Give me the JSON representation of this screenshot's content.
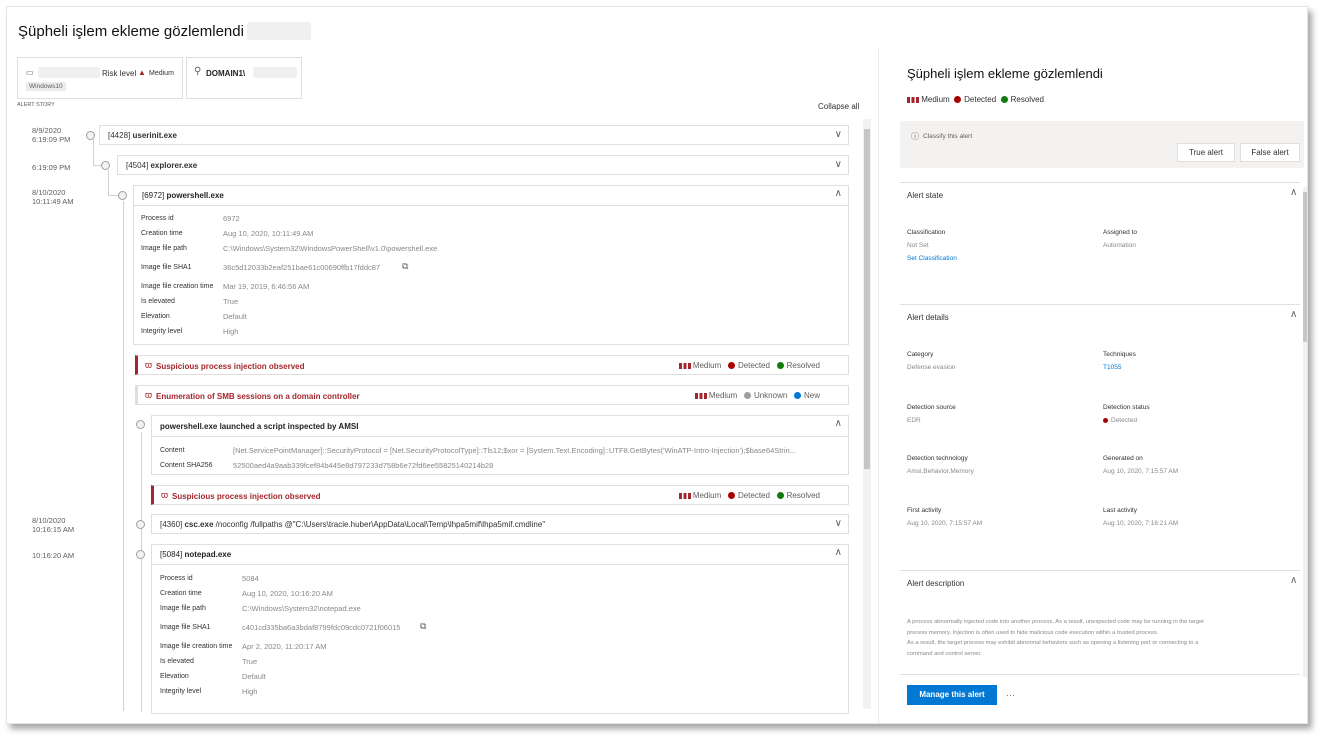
{
  "page_title": "Şüpheli işlem ekleme gözlemlendi",
  "device_card": {
    "risk_label": "Risk level",
    "risk_value": "Medium",
    "os_tag": "Windows10",
    "user": "DOMAIN1\\"
  },
  "alert_story_label": "ALERT STORY",
  "collapse_all": "Collapse all",
  "timeline": {
    "dates": [
      {
        "d": "8/9/2020",
        "t": "6:19:09 PM"
      },
      {
        "d": "",
        "t": "6:19:09 PM"
      },
      {
        "d": "8/10/2020",
        "t": "10:11:49 AM"
      },
      {
        "d": "8/10/2020",
        "t": "10:16:15 AM"
      },
      {
        "d": "",
        "t": "10:16:20 AM"
      }
    ],
    "proc1": {
      "pid": "[4428]",
      "name": "userinit.exe"
    },
    "proc2": {
      "pid": "[4504]",
      "name": "explorer.exe"
    },
    "proc3": {
      "pid": "[6972]",
      "name": "powershell.exe"
    },
    "proc3_details": [
      {
        "k": "Process id",
        "v": "6972"
      },
      {
        "k": "Creation time",
        "v": "Aug 10, 2020, 10:11:49 AM"
      },
      {
        "k": "Image file path",
        "v": "C:\\Windows\\System32\\WindowsPowerShell\\v1.0\\powershell.exe"
      },
      {
        "k": "Image file SHA1",
        "v": "36c5d12033b2eaf251bae61c00690ffb17fddc87"
      },
      {
        "k": "Image file creation time",
        "v": "Mar 19, 2019, 6:46:56 AM"
      },
      {
        "k": "Is elevated",
        "v": "True"
      },
      {
        "k": "Elevation",
        "v": "Default"
      },
      {
        "k": "Integrity level",
        "v": "High"
      }
    ],
    "alert1": {
      "title": "Suspicious process injection observed",
      "sev": "Medium",
      "det": "Detected",
      "status": "Resolved"
    },
    "alert2": {
      "title": "Enumeration of SMB sessions on a domain controller",
      "sev": "Medium",
      "det": "Unknown",
      "status": "New"
    },
    "amsi": {
      "title": "powershell.exe launched a script inspected by AMSI",
      "content_k": "Content",
      "content_v": "[Net.ServicePointManager]::SecurityProtocol = [Net.SecurityProtocolType]::Tls12;$xor = [System.Text.Encoding]::UTF8.GetBytes('WinATP-Intro-Injection');$base64Strin...",
      "sha_k": "Content SHA256",
      "sha_v": "52500aed4a9aab339fcef84b445e8d797233d758b6e72fd6ee55825140214b28"
    },
    "alert3": {
      "title": "Suspicious process injection observed",
      "sev": "Medium",
      "det": "Detected",
      "status": "Resolved"
    },
    "proc4": {
      "pid": "[4360]",
      "name": "csc.exe",
      "args": "/noconfig /fullpaths @\"C:\\Users\\tracie.huber\\AppData\\Local\\Temp\\lhpa5mif\\lhpa5mif.cmdline\""
    },
    "proc5": {
      "pid": "[5084]",
      "name": "notepad.exe"
    },
    "proc5_details": [
      {
        "k": "Process id",
        "v": "5084"
      },
      {
        "k": "Creation time",
        "v": "Aug 10, 2020, 10:16:20 AM"
      },
      {
        "k": "Image file path",
        "v": "C:\\Windows\\System32\\notepad.exe"
      },
      {
        "k": "Image file SHA1",
        "v": "c401cd335ba6a3bdaf8799fdc09cdc0721f06015"
      },
      {
        "k": "Image file creation time",
        "v": "Apr 2, 2020, 11:20:17 AM"
      },
      {
        "k": "Is elevated",
        "v": "True"
      },
      {
        "k": "Elevation",
        "v": "Default"
      },
      {
        "k": "Integrity level",
        "v": "High"
      }
    ]
  },
  "right_panel": {
    "title": "Şüpheli işlem ekleme gözlemlendi",
    "sev": "Medium",
    "det": "Detected",
    "status": "Resolved",
    "classify": "Classify this alert",
    "true_alert": "True alert",
    "false_alert": "False alert",
    "alert_state": "Alert state",
    "classification_k": "Classification",
    "classification_v": "Not Set",
    "set_classification": "Set Classification",
    "assigned_k": "Assigned to",
    "assigned_v": "Automation",
    "alert_details": "Alert details",
    "category_k": "Category",
    "category_v": "Defense evasion",
    "techniques_k": "Techniques",
    "techniques_v": "T1055",
    "det_source_k": "Detection source",
    "det_source_v": "EDR",
    "det_status_k": "Detection status",
    "det_status_v": "Detected",
    "det_tech_k": "Detection technology",
    "det_tech_v": "Amsi,Behavior,Memory",
    "generated_k": "Generated on",
    "generated_v": "Aug 10, 2020, 7:15:57 AM",
    "first_k": "First activity",
    "first_v": "Aug 10, 2020, 7:15:57 AM",
    "last_k": "Last activity",
    "last_v": "Aug 10, 2020, 7:16:21 AM",
    "alert_description": "Alert description",
    "desc1": "A process abnormally injected code into another process, As a result, unexpected code may be running in the target",
    "desc2": "process memory. Injection is often used to hide malicious code execution within a trusted process.",
    "desc3": "As a result, the target process may exhibit abnormal behaviors such as opening a listening port or connecting to a",
    "desc4": "command and control server.",
    "manage": "Manage this alert",
    "more": "···"
  },
  "colors": {
    "severity": "#a4262c",
    "detected": "#a80000",
    "resolved": "#107c10",
    "new": "#0078d4",
    "unknown": "#a19f9d",
    "accent": "#0078d4"
  }
}
